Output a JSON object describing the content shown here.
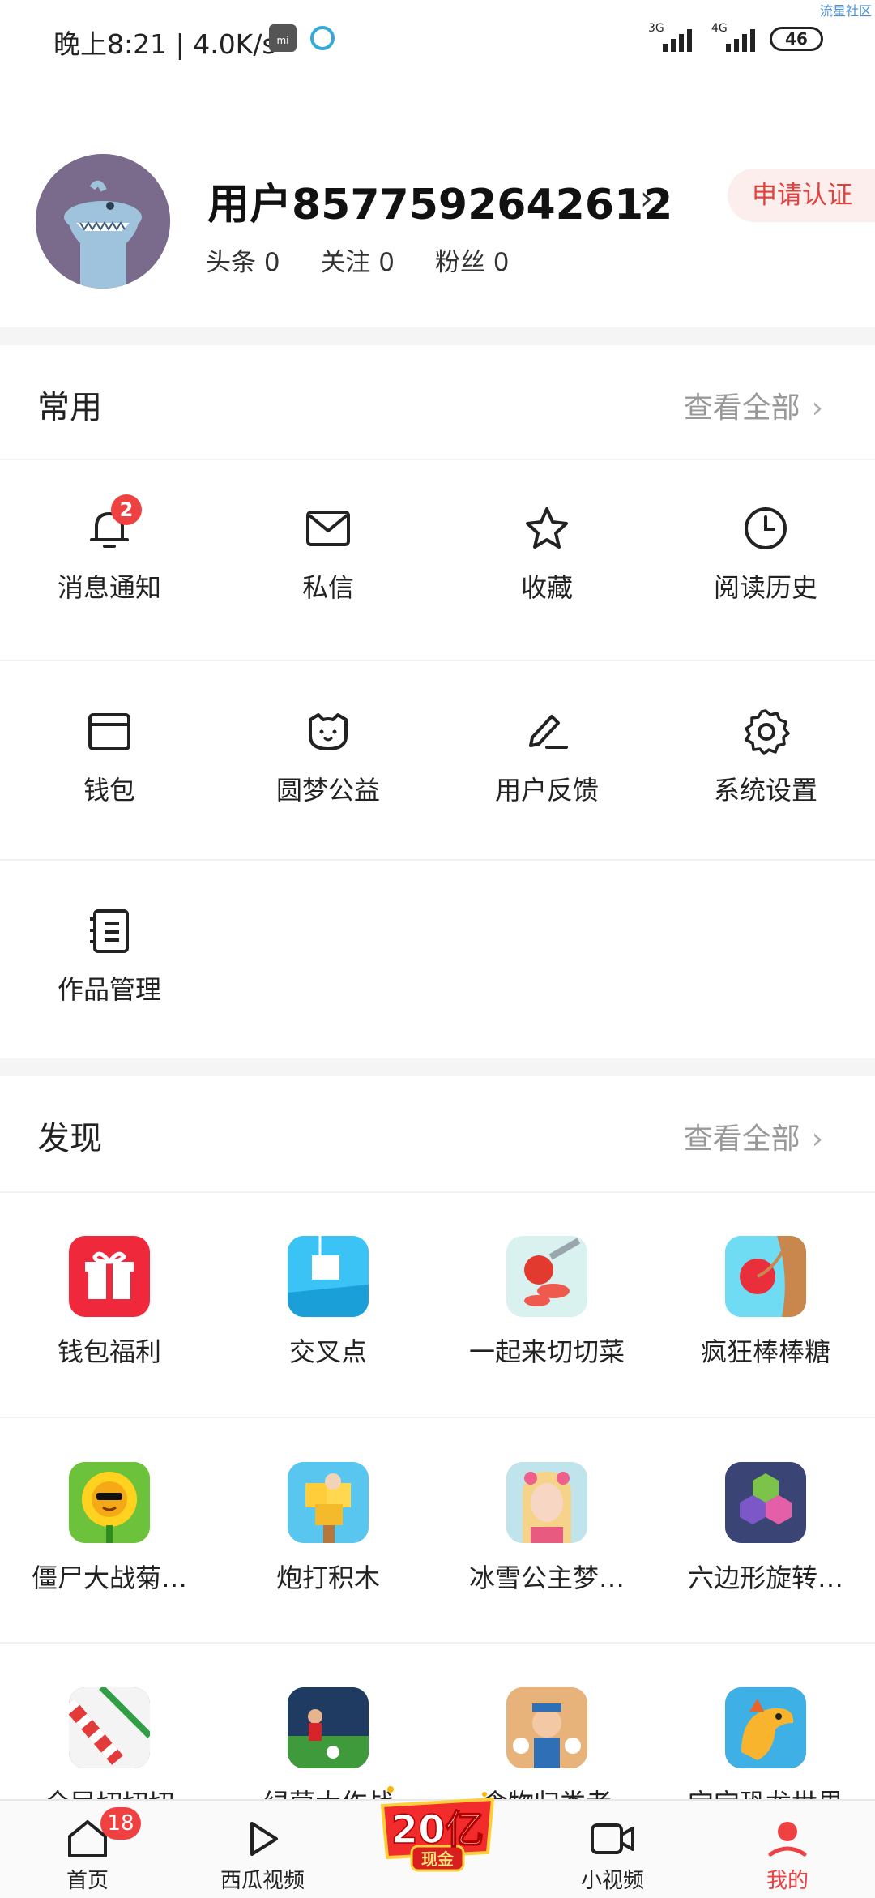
{
  "status_bar": {
    "time": "晚上8:21 | 4.0K/s",
    "mi_icon": "mi",
    "signal1_label": "3G",
    "signal2_label": "4G",
    "battery": "46",
    "corner_text": "流星社区"
  },
  "profile": {
    "username": "用户8577592642612",
    "certify_label": "申请认证",
    "stats": {
      "toutiao": "头条 0",
      "follow": "关注 0",
      "fans": "粉丝 0"
    }
  },
  "common_section": {
    "title": "常用",
    "more_label": "查看全部",
    "items": [
      {
        "label": "消息通知",
        "icon": "bell-icon",
        "badge": "2"
      },
      {
        "label": "私信",
        "icon": "mail-icon"
      },
      {
        "label": "收藏",
        "icon": "star-icon"
      },
      {
        "label": "阅读历史",
        "icon": "clock-icon"
      },
      {
        "label": "钱包",
        "icon": "wallet-icon"
      },
      {
        "label": "圆梦公益",
        "icon": "charity-face-icon"
      },
      {
        "label": "用户反馈",
        "icon": "pen-icon"
      },
      {
        "label": "系统设置",
        "icon": "gear-icon"
      },
      {
        "label": "作品管理",
        "icon": "notebook-icon"
      }
    ]
  },
  "discover_section": {
    "title": "发现",
    "more_label": "查看全部",
    "items": [
      {
        "label": "钱包福利",
        "icon": "gift-app-icon",
        "color": "#f0283c"
      },
      {
        "label": "交叉点",
        "icon": "crossing-game-icon",
        "color": "#2ab2ef"
      },
      {
        "label": "一起来切切菜",
        "icon": "cut-veggies-game-icon",
        "color": "#e9f6f4"
      },
      {
        "label": "疯狂棒棒糖",
        "icon": "lollipop-game-icon",
        "color": "#5dd6f2"
      },
      {
        "label": "僵尸大战菊…",
        "icon": "sunflower-game-icon",
        "color": "#5eb82f"
      },
      {
        "label": "炮打积木",
        "icon": "blocks-game-icon",
        "color": "#4fc0ee"
      },
      {
        "label": "冰雪公主梦…",
        "icon": "princess-game-icon",
        "color": "#f3c0c8"
      },
      {
        "label": "六边形旋转…",
        "icon": "hexagon-game-icon",
        "color": "#3f4a7a"
      },
      {
        "label": "全民切切切",
        "icon": "candy-cut-game-icon",
        "color": "#d93b43"
      },
      {
        "label": "绿茵大作战",
        "icon": "soccer-game-icon",
        "color": "#2f6e2f"
      },
      {
        "label": "食物归类者",
        "icon": "food-sort-game-icon",
        "color": "#c98a53"
      },
      {
        "label": "宝宝恐龙世界",
        "icon": "dino-game-icon",
        "color": "#f19a2d"
      }
    ]
  },
  "bottom_nav": {
    "items": [
      {
        "label": "首页",
        "icon": "home-icon",
        "badge": "18"
      },
      {
        "label": "西瓜视频",
        "icon": "play-icon"
      },
      {
        "label": "小视频",
        "icon": "video-camera-icon"
      },
      {
        "label": "我的",
        "icon": "profile-icon"
      }
    ],
    "promo": {
      "big": "20亿",
      "small": "现金"
    },
    "active_color": "#f04142"
  }
}
